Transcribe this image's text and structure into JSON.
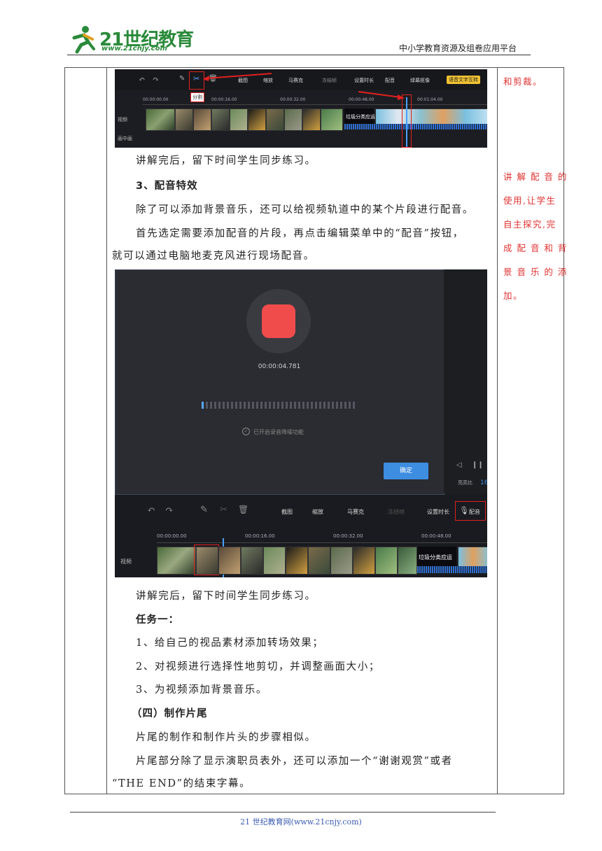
{
  "header": {
    "logo_text": "21世纪教育",
    "logo_url": "www.21cnjy.com",
    "platform": "中小学教育资源及组卷应用平台"
  },
  "screenshot1": {
    "toolbar": [
      "截图",
      "缩放",
      "马赛克",
      "冻结帧",
      "设置时长",
      "配音",
      "绿幕抠像"
    ],
    "toolbar_badge": "语音文字互转",
    "split_tooltip": "分割",
    "ticks": [
      "00:00:00.00",
      "00:00:16.00",
      "00:00:32.00",
      "00:00:48.00",
      "00:01:04.00"
    ],
    "track_video": "视频",
    "track_pip": "画中画",
    "clip_label": "垃圾分类应运"
  },
  "screenshot2": {
    "timer": "00:00:04.781",
    "noise_reduction": "已开启录音降噪功能",
    "confirm": "确定",
    "side_label": "亮高比",
    "side_num": "16",
    "toolbar": [
      "截图",
      "缩放",
      "马赛克",
      "冻结帧",
      "设置时长",
      "配音"
    ],
    "ticks": [
      "00:00:00.00",
      "00:00:16.00",
      "00:00:32.00",
      "00:00:48.00"
    ],
    "track_video": "视频",
    "clip_label": "垃圾分类应运"
  },
  "main": {
    "p1": "讲解完后，留下时间学生同步练习。",
    "h1": "3、配音特效",
    "p2": "除了可以添加背景音乐，还可以给视频轨道中的某个片段进行配音。",
    "p3a": "首先选定需要添加配音的片段，再点击编辑菜单中的“配音”按钮，",
    "p3b": "就可以通过电脑地麦克风进行现场配音。",
    "p4": "讲解完后，留下时间学生同步练习。",
    "task_title": "任务一：",
    "task1": "1、给自己的视品素材添加转场效果；",
    "task2": "2、对视频进行选择性地剪切，并调整画面大小；",
    "task3": "3、为视频添加背景音乐。",
    "h2": "（四）制作片尾",
    "p5": "片尾的制作和制作片头的步骤相似。",
    "p6a": "片尾部分除了显示演职员表外，还可以添加一个“谢谢观赏”或者",
    "p6b": "“THE  END”的结束字幕。"
  },
  "notes": {
    "n1": "和剪裁。",
    "n2": [
      "讲 解 配 音 的",
      "使用,让学生",
      "自主探究,完",
      "成 配 音 和 背",
      "景 音 乐 的 添",
      "加。"
    ]
  },
  "footer": {
    "text": "21 世纪教育网(www.21cnjy.com)"
  },
  "colors": {
    "note_red": "#e03030",
    "logo_green": "#2a8a3a",
    "footer_blue": "#3a5bb0",
    "record_red": "#f04c4c",
    "confirm_blue": "#3d8de0"
  }
}
